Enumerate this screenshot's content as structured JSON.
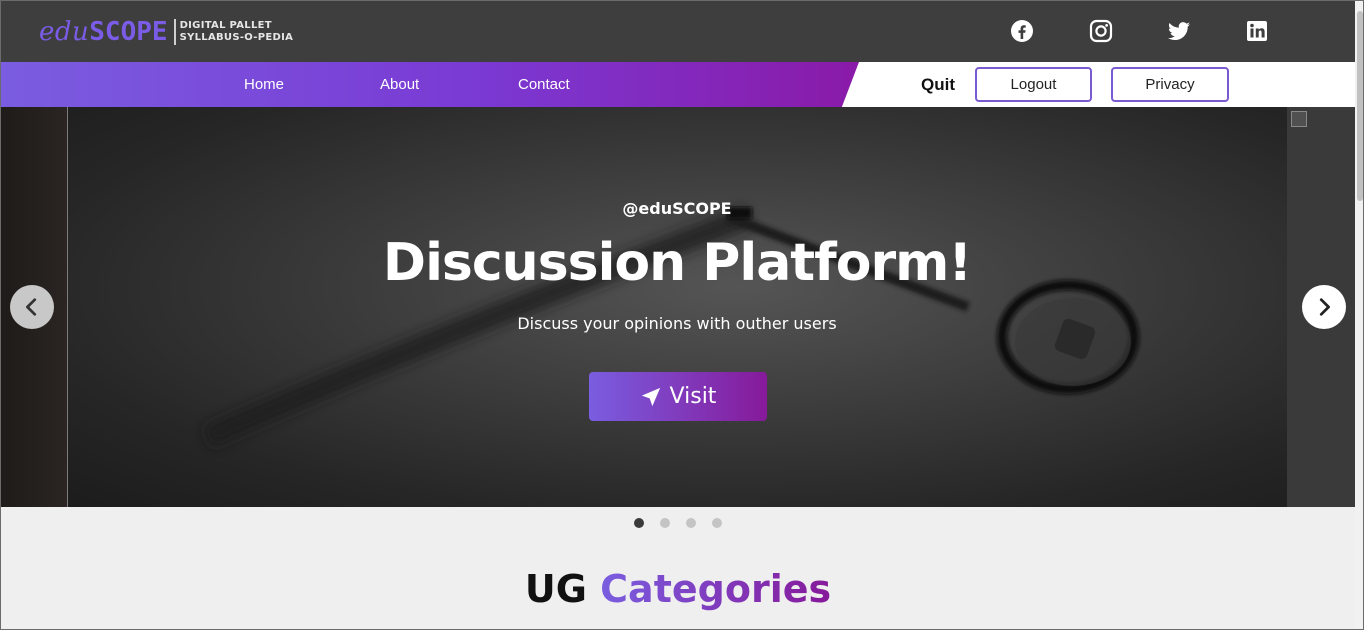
{
  "brand": {
    "logo_edu": "edu",
    "logo_scope": "SCOPE",
    "tagline_line1": "DIGITAL PALLET",
    "tagline_line2": "SYLLABUS-O-PEDIA"
  },
  "social": [
    "facebook-icon",
    "instagram-icon",
    "twitter-icon",
    "linkedin-icon"
  ],
  "nav": {
    "links": [
      "Home",
      "About",
      "Contact"
    ],
    "quit_label": "Quit",
    "logout_label": "Logout",
    "privacy_label": "Privacy"
  },
  "hero": {
    "handle": "@eduSCOPE",
    "title": "Discussion Platform!",
    "subtitle": "Discuss your opinions with outher users",
    "button_label": "Visit",
    "slide_count": 4,
    "active_slide": 1
  },
  "section": {
    "heading_part1": "UG",
    "heading_part2": "Categories"
  },
  "colors": {
    "accent_start": "#7a5de0",
    "accent_end": "#861a9a",
    "topbar_bg": "#3e3e3e"
  }
}
